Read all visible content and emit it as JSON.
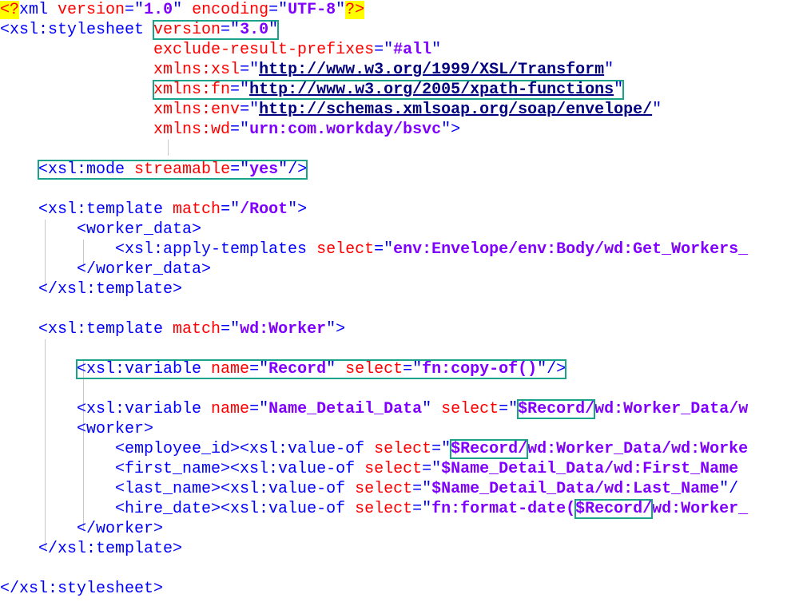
{
  "lines": [
    {
      "segs": [
        {
          "cls": "y",
          "text": "<?"
        },
        {
          "cls": "t",
          "text": "xml "
        },
        {
          "cls": "a",
          "text": "version"
        },
        {
          "cls": "t",
          "text": "=\""
        },
        {
          "cls": "v",
          "text": "1.0"
        },
        {
          "cls": "t",
          "text": "\" "
        },
        {
          "cls": "a",
          "text": "encoding"
        },
        {
          "cls": "t",
          "text": "=\""
        },
        {
          "cls": "v",
          "text": "UTF-8"
        },
        {
          "cls": "t",
          "text": "\""
        },
        {
          "cls": "y",
          "text": "?>"
        }
      ]
    },
    {
      "segs": [
        {
          "cls": "t",
          "text": "<xsl:stylesheet "
        },
        {
          "cls": "a",
          "text": "version",
          "box": "start"
        },
        {
          "cls": "t",
          "text": "=\""
        },
        {
          "cls": "v",
          "text": "3.0"
        },
        {
          "cls": "t",
          "text": "\"",
          "box": "end"
        }
      ]
    },
    {
      "segs": [
        {
          "cls": "t",
          "text": "                "
        },
        {
          "cls": "a",
          "text": "exclude-result-prefixes"
        },
        {
          "cls": "t",
          "text": "=\""
        },
        {
          "cls": "v",
          "text": "#all"
        },
        {
          "cls": "t",
          "text": "\""
        }
      ]
    },
    {
      "segs": [
        {
          "cls": "t",
          "text": "                "
        },
        {
          "cls": "a",
          "text": "xmlns:xsl"
        },
        {
          "cls": "t",
          "text": "=\""
        },
        {
          "cls": "u",
          "text": "http://www.w3.org/1999/XSL/Transform"
        },
        {
          "cls": "t",
          "text": "\""
        }
      ]
    },
    {
      "segs": [
        {
          "cls": "t",
          "text": "                "
        },
        {
          "cls": "a",
          "text": "xmlns:fn",
          "box": "start"
        },
        {
          "cls": "t",
          "text": "=\""
        },
        {
          "cls": "u",
          "text": "http://www.w3.org/2005/xpath-functions"
        },
        {
          "cls": "t",
          "text": "\"",
          "box": "end"
        }
      ]
    },
    {
      "segs": [
        {
          "cls": "t",
          "text": "                "
        },
        {
          "cls": "a",
          "text": "xmlns:env"
        },
        {
          "cls": "t",
          "text": "=\""
        },
        {
          "cls": "u",
          "text": "http://schemas.xmlsoap.org/soap/envelope/"
        },
        {
          "cls": "t",
          "text": "\""
        }
      ]
    },
    {
      "segs": [
        {
          "cls": "t",
          "text": "                "
        },
        {
          "cls": "a",
          "text": "xmlns:wd"
        },
        {
          "cls": "t",
          "text": "=\""
        },
        {
          "cls": "v",
          "text": "urn:com.workday/bsvc"
        },
        {
          "cls": "t",
          "text": "\">"
        }
      ]
    },
    {
      "segs": []
    },
    {
      "segs": [
        {
          "cls": "t",
          "text": "    "
        },
        {
          "cls": "t",
          "text": "<xsl:mode ",
          "box": "start"
        },
        {
          "cls": "a",
          "text": "streamable"
        },
        {
          "cls": "t",
          "text": "=\""
        },
        {
          "cls": "v",
          "text": "yes"
        },
        {
          "cls": "t",
          "text": "\"/>",
          "box": "end"
        }
      ]
    },
    {
      "segs": []
    },
    {
      "segs": [
        {
          "cls": "t",
          "text": "    <xsl:template "
        },
        {
          "cls": "a",
          "text": "match"
        },
        {
          "cls": "t",
          "text": "=\""
        },
        {
          "cls": "v",
          "text": "/Root"
        },
        {
          "cls": "t",
          "text": "\">"
        }
      ]
    },
    {
      "segs": [
        {
          "cls": "t",
          "text": "        <worker_data>"
        }
      ]
    },
    {
      "segs": [
        {
          "cls": "t",
          "text": "            <xsl:apply-templates "
        },
        {
          "cls": "a",
          "text": "select"
        },
        {
          "cls": "t",
          "text": "=\""
        },
        {
          "cls": "v",
          "text": "env:Envelope/env:Body/wd:Get_Workers_"
        }
      ]
    },
    {
      "segs": [
        {
          "cls": "t",
          "text": "        </worker_data>"
        }
      ]
    },
    {
      "segs": [
        {
          "cls": "t",
          "text": "    </xsl:template>"
        }
      ]
    },
    {
      "segs": []
    },
    {
      "segs": [
        {
          "cls": "t",
          "text": "    <xsl:template "
        },
        {
          "cls": "a",
          "text": "match"
        },
        {
          "cls": "t",
          "text": "=\""
        },
        {
          "cls": "v",
          "text": "wd:Worker"
        },
        {
          "cls": "t",
          "text": "\">"
        }
      ]
    },
    {
      "segs": []
    },
    {
      "segs": [
        {
          "cls": "t",
          "text": "        "
        },
        {
          "cls": "t",
          "text": "<xsl:variable ",
          "box": "start"
        },
        {
          "cls": "a",
          "text": "name"
        },
        {
          "cls": "t",
          "text": "=\""
        },
        {
          "cls": "v",
          "text": "Record"
        },
        {
          "cls": "t",
          "text": "\" "
        },
        {
          "cls": "a",
          "text": "select"
        },
        {
          "cls": "t",
          "text": "=\""
        },
        {
          "cls": "v",
          "text": "fn:copy-of()"
        },
        {
          "cls": "t",
          "text": "\"/>",
          "box": "end"
        }
      ]
    },
    {
      "segs": []
    },
    {
      "segs": [
        {
          "cls": "t",
          "text": "        <xsl:variable "
        },
        {
          "cls": "a",
          "text": "name"
        },
        {
          "cls": "t",
          "text": "=\""
        },
        {
          "cls": "v",
          "text": "Name_Detail_Data"
        },
        {
          "cls": "t",
          "text": "\" "
        },
        {
          "cls": "a",
          "text": "select"
        },
        {
          "cls": "t",
          "text": "=\""
        },
        {
          "cls": "v",
          "text": "$Record/",
          "box": "single"
        },
        {
          "cls": "v",
          "text": "wd:Worker_Data/w"
        }
      ]
    },
    {
      "segs": [
        {
          "cls": "t",
          "text": "        <worker>"
        }
      ]
    },
    {
      "segs": [
        {
          "cls": "t",
          "text": "            <employee_id><xsl:value-of "
        },
        {
          "cls": "a",
          "text": "select"
        },
        {
          "cls": "t",
          "text": "=\""
        },
        {
          "cls": "v",
          "text": "$Record/",
          "box": "single"
        },
        {
          "cls": "v",
          "text": "wd:Worker_Data/wd:Worke"
        }
      ]
    },
    {
      "segs": [
        {
          "cls": "t",
          "text": "            <first_name><xsl:value-of "
        },
        {
          "cls": "a",
          "text": "select"
        },
        {
          "cls": "t",
          "text": "=\""
        },
        {
          "cls": "v",
          "text": "$Name_Detail_Data/wd:First_Name"
        }
      ]
    },
    {
      "segs": [
        {
          "cls": "t",
          "text": "            <last_name><xsl:value-of "
        },
        {
          "cls": "a",
          "text": "select"
        },
        {
          "cls": "t",
          "text": "=\""
        },
        {
          "cls": "v",
          "text": "$Name_Detail_Data/wd:Last_Name"
        },
        {
          "cls": "t",
          "text": "\"/"
        }
      ]
    },
    {
      "segs": [
        {
          "cls": "t",
          "text": "            <hire_date><xsl:value-of "
        },
        {
          "cls": "a",
          "text": "select"
        },
        {
          "cls": "t",
          "text": "=\""
        },
        {
          "cls": "v",
          "text": "fn:format-date("
        },
        {
          "cls": "v",
          "text": "$Record/",
          "box": "single"
        },
        {
          "cls": "v",
          "text": "wd:Worker_"
        }
      ]
    },
    {
      "segs": [
        {
          "cls": "t",
          "text": "        </worker>"
        }
      ]
    },
    {
      "segs": [
        {
          "cls": "t",
          "text": "    </xsl:template>"
        }
      ]
    },
    {
      "segs": []
    },
    {
      "segs": [
        {
          "cls": "t",
          "text": "</xsl:stylesheet>"
        }
      ]
    }
  ]
}
